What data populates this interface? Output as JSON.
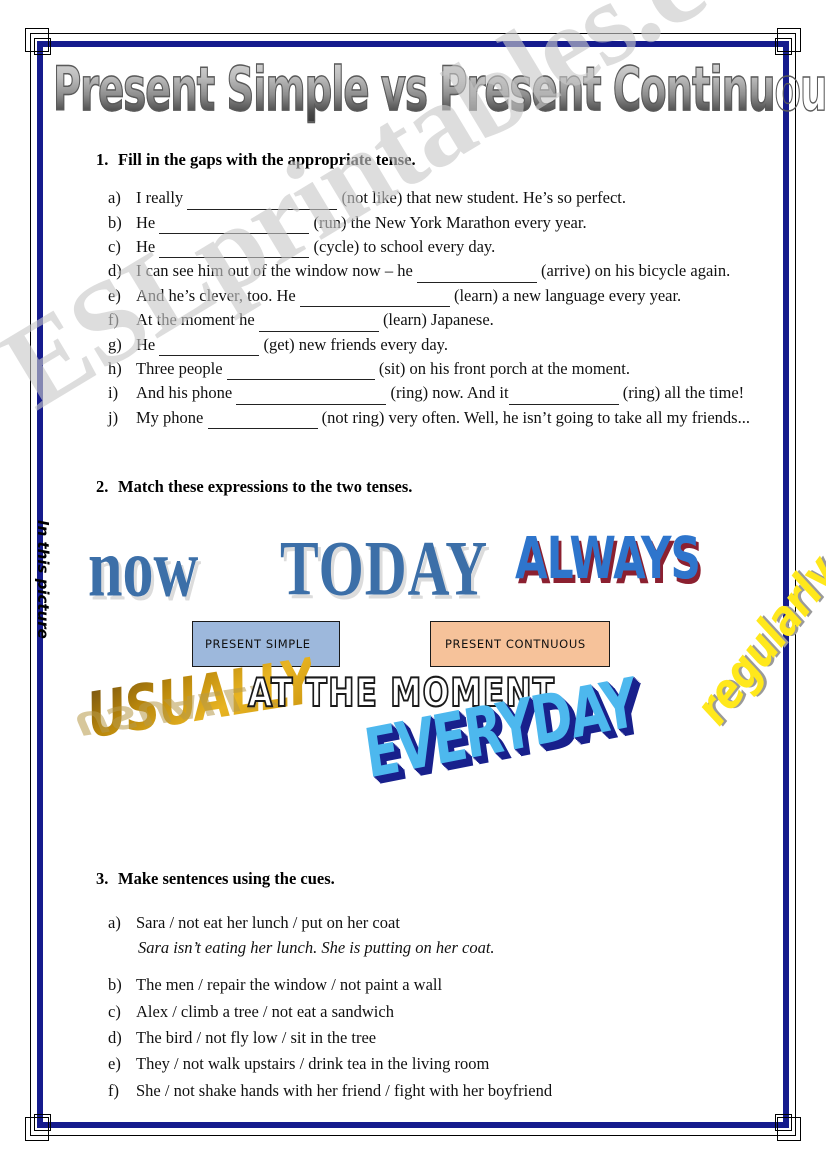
{
  "worksheet": {
    "title": "Present Simple vs Present Continuous",
    "side_note": "In this picture",
    "watermark": "ESLprintables.com"
  },
  "exercise1": {
    "number": "1.",
    "heading": "Fill in the gaps with the appropriate tense.",
    "items": [
      {
        "label": "a)",
        "before": "I really",
        "gap_width": 150,
        "after": "(not like) that new student. He’s so perfect."
      },
      {
        "label": "b)",
        "before": "He",
        "gap_width": 150,
        "after": "(run) the New York Marathon every year."
      },
      {
        "label": "c)",
        "before": "He",
        "gap_width": 150,
        "after": "(cycle) to school every day."
      },
      {
        "label": "d)",
        "before": "I can see him out of the window now – he",
        "gap_width": 120,
        "after": "(arrive) on his bicycle again."
      },
      {
        "label": "e)",
        "before": "And he’s clever, too. He",
        "gap_width": 150,
        "after": "(learn) a new language every year."
      },
      {
        "label": "f)",
        "before": "At the moment he",
        "gap_width": 120,
        "after": "(learn) Japanese."
      },
      {
        "label": "g)",
        "before": "He",
        "gap_width": 100,
        "after": "(get) new friends every day."
      },
      {
        "label": "h)",
        "before": "Three people",
        "gap_width": 148,
        "after": "(sit) on his front porch at the moment."
      },
      {
        "label": "i)",
        "before": "And his phone",
        "gap_width": 150,
        "after": "(ring) now. And it",
        "gap2_width": 110,
        "after2": "(ring) all the time!"
      },
      {
        "label": "j)",
        "before": "My phone",
        "gap_width": 110,
        "after": "(not ring) very often. Well, he isn’t going to take all my friends..."
      }
    ]
  },
  "exercise2": {
    "number": "2.",
    "heading": "Match these expressions to the two tenses.",
    "expressions": [
      {
        "name": "now",
        "text": "now"
      },
      {
        "name": "today",
        "text": "TODAY"
      },
      {
        "name": "always",
        "text": "ALWAYS"
      },
      {
        "name": "usually",
        "text": "USUALLY"
      },
      {
        "name": "at-the-moment",
        "text": "AT THE MOMENT"
      },
      {
        "name": "everyday",
        "text": "EVERYDAY"
      },
      {
        "name": "regularly",
        "text": "regularly"
      }
    ],
    "tense_boxes": [
      {
        "label": "PRESENT SIMPLE",
        "color": "#9db8dc"
      },
      {
        "label": "PRESENT CONTNUOUS",
        "color": "#f6c29a"
      }
    ]
  },
  "exercise3": {
    "number": "3.",
    "heading": "Make sentences using the cues.",
    "items": [
      {
        "label": "a)",
        "cue": "Sara / not eat her lunch / put on her coat",
        "answer": "Sara isn’t eating her lunch. She is putting on her coat."
      },
      {
        "label": "b)",
        "cue": " The men / repair the window / not paint a wall",
        "answer": ""
      },
      {
        "label": "c)",
        "cue": "Alex / climb a tree / not eat a sandwich",
        "answer": ""
      },
      {
        "label": "d)",
        "cue": "The bird / not fly low / sit in the tree",
        "answer": ""
      },
      {
        "label": "e)",
        "cue": "They / not walk upstairs / drink tea in the living room",
        "answer": ""
      },
      {
        "label": "f)",
        "cue": "She / not shake hands with her friend / fight with her boyfriend",
        "answer": ""
      }
    ]
  },
  "colors": {
    "border_navy": "#151b8d",
    "always_blue": "#2e75cc",
    "always_shadow": "#8b2030",
    "now_blue": "#3c6fa8",
    "everyday_light": "#4db8ee",
    "everyday_dark": "#18208c",
    "regularly_yellow": "#ffe81c",
    "usually_gold": "#c8920e"
  }
}
